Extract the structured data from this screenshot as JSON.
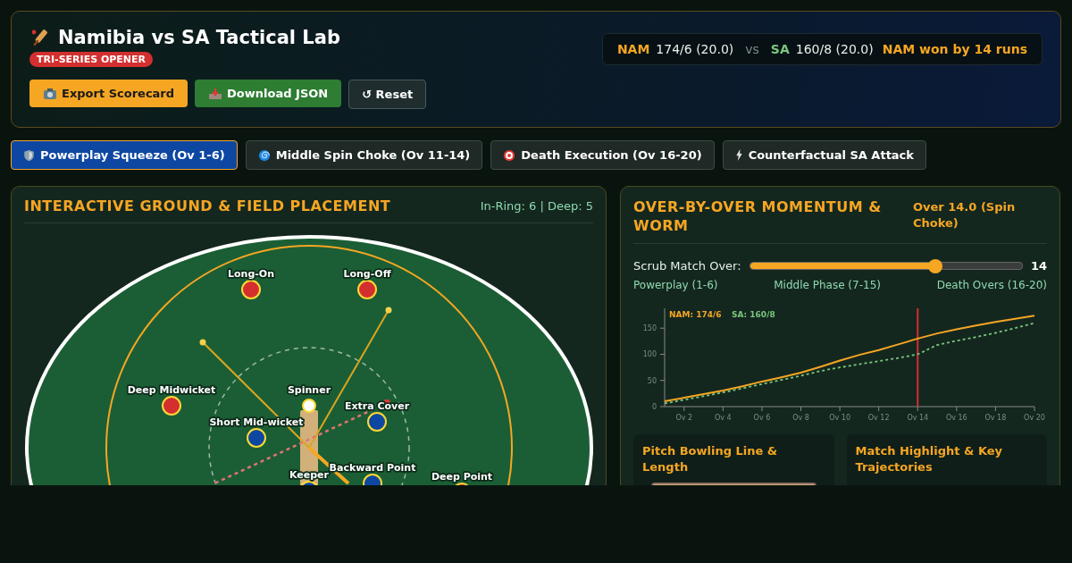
{
  "header": {
    "title": "Namibia vs SA Tactical Lab",
    "badge": "TRI-SERIES OPENER",
    "buttons": [
      {
        "label": "Export Scorecard",
        "kind": "primary"
      },
      {
        "label": "Download JSON",
        "kind": "success"
      },
      {
        "label": "↺ Reset",
        "kind": "plain"
      }
    ],
    "score": {
      "team1": "NAM",
      "team1_score": "174/6 (20.0)",
      "vs": "vs",
      "team2": "SA",
      "team2_score": "160/8 (20.0)",
      "result": "NAM won by 14 runs"
    }
  },
  "tabs": [
    {
      "label": "Powerplay Squeeze (Ov 1-6)",
      "selected": true
    },
    {
      "label": "Middle Spin Choke (Ov 11-14)",
      "selected": false
    },
    {
      "label": "Death Execution (Ov 16-20)",
      "selected": false
    },
    {
      "label": "Counterfactual SA Attack",
      "selected": false
    }
  ],
  "ground": {
    "title": "INTERACTIVE GROUND & FIELD PLACEMENT",
    "summary": "In-Ring: 6 | Deep: 5",
    "fielders": [
      {
        "name": "Long-On",
        "kind": "deep"
      },
      {
        "name": "Long-Off",
        "kind": "deep"
      },
      {
        "name": "Deep Midwicket",
        "kind": "deep"
      },
      {
        "name": "Spinner",
        "kind": "bowler"
      },
      {
        "name": "Extra Cover",
        "kind": "ring"
      },
      {
        "name": "Short Mid-wicket",
        "kind": "ring"
      },
      {
        "name": "Keeper",
        "kind": "ring"
      },
      {
        "name": "Backward Point",
        "kind": "ring"
      },
      {
        "name": "Deep Point",
        "kind": "deep"
      }
    ]
  },
  "momentum": {
    "title": "OVER-BY-OVER MOMENTUM & WORM",
    "over_status": "Over 14.0 (Spin Choke)",
    "slider": {
      "label": "Scrub Match Over:",
      "level": 0.68,
      "reading": "14"
    },
    "phases": [
      "Powerplay (1-6)",
      "Middle Phase (7-15)",
      "Death Overs (16-20)"
    ],
    "chart_data": {
      "type": "line",
      "categories": [
        null,
        "Ov 2",
        null,
        "Ov 4",
        null,
        "Ov 6",
        null,
        "Ov 8",
        null,
        "Ov 10",
        null,
        "Ov 12",
        null,
        "Ov 14",
        null,
        "Ov 16",
        null,
        "Ov 18",
        null,
        "Ov 20"
      ],
      "series": [
        {
          "name": "NAM: 174/6",
          "color": "#f5a623",
          "line_style": "solid",
          "values": [
            10,
            17,
            24,
            31,
            39,
            48,
            56,
            65,
            76,
            88,
            99,
            108,
            119,
            130,
            140,
            148,
            155,
            162,
            168,
            174
          ]
        },
        {
          "name": "SA: 160/8",
          "color": "#7bc67e",
          "line_style": "dashed",
          "values": [
            6,
            13,
            20,
            27,
            35,
            43,
            51,
            59,
            68,
            75,
            81,
            87,
            93,
            100,
            118,
            126,
            133,
            141,
            150,
            160
          ]
        }
      ],
      "yticks": [
        0,
        50,
        100,
        150
      ],
      "ylim": [
        0,
        188
      ],
      "annotations": [
        {
          "x": "Ov 14"
        }
      ]
    },
    "cards": [
      {
        "title": "Pitch Bowling Line & Length",
        "kind": "pitch"
      },
      {
        "title": "Match Highlight & Key Trajectories",
        "kind": "text"
      }
    ]
  }
}
